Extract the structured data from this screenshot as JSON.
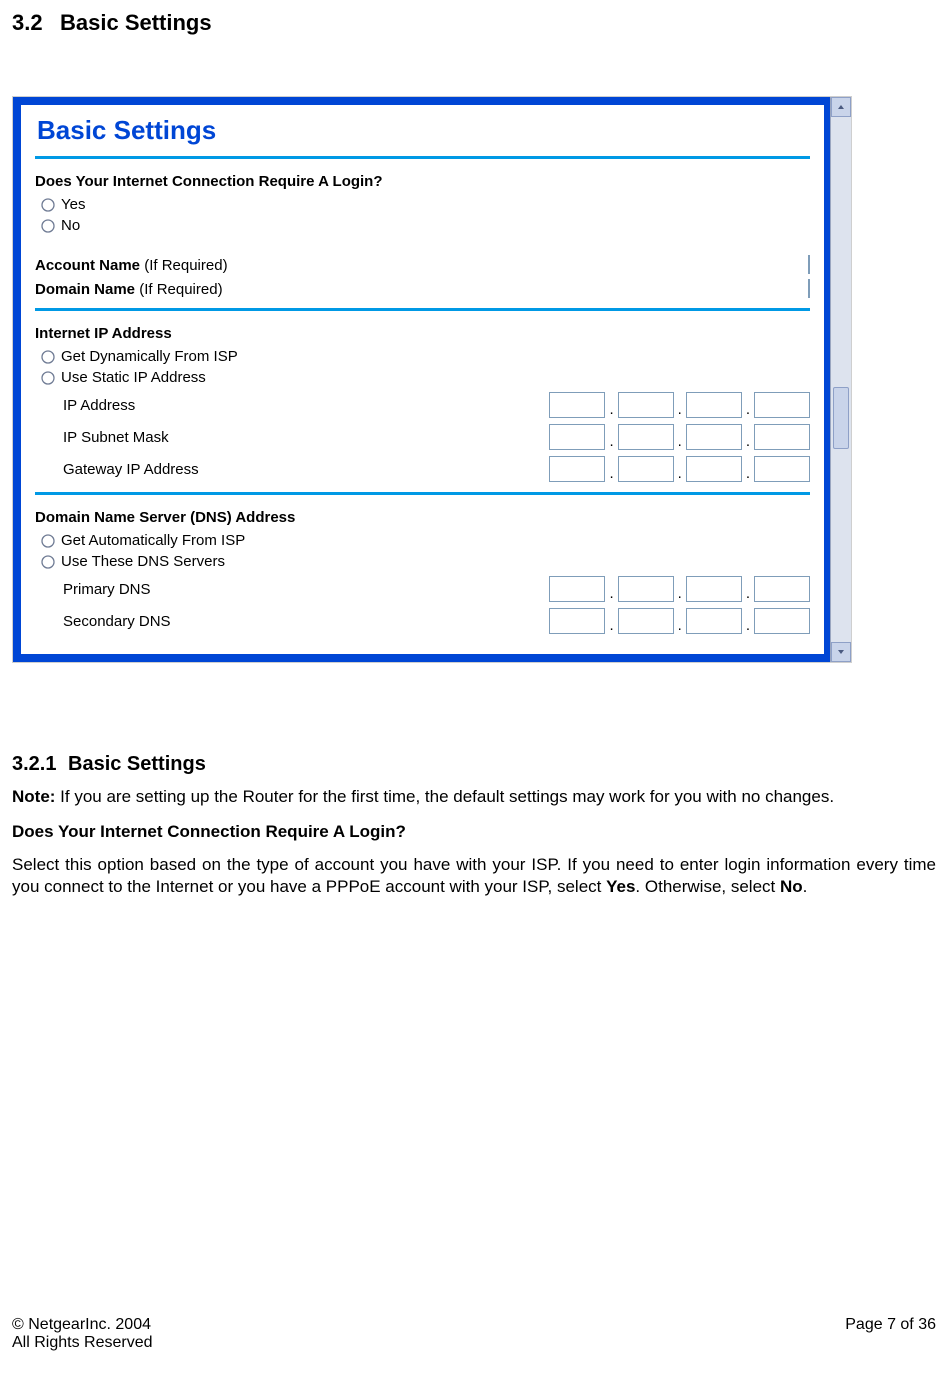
{
  "heading32": {
    "num": "3.2",
    "title": "Basic Settings"
  },
  "screenshot": {
    "brand_title": "Basic Settings",
    "q_login": "Does Your Internet Connection Require A Login?",
    "opt_yes": "Yes",
    "opt_no": "No",
    "account_name_b": "Account Name",
    "account_name_paren": "  (If Required)",
    "domain_name_b": "Domain Name",
    "domain_name_paren": "  (If Required)",
    "sect_ip": "Internet IP Address",
    "ip_dyn": "Get Dynamically From ISP",
    "ip_static": "Use Static IP Address",
    "ip_addr": "IP Address",
    "ip_mask": "IP Subnet Mask",
    "ip_gw": "Gateway IP Address",
    "sect_dns": "Domain Name Server (DNS) Address",
    "dns_auto": "Get Automatically From ISP",
    "dns_use": "Use These DNS Servers",
    "dns_prim": "Primary DNS",
    "dns_sec": "Secondary DNS"
  },
  "heading321": {
    "num": "3.2.1",
    "title": "Basic Settings"
  },
  "note_b": "Note:",
  "note_rest": " If you are setting up the Router for the first time, the default settings may work for you with no changes.",
  "subhead_login": "Does Your Internet Connection Require A Login?",
  "para_login_1": "Select this option based on the type of account you have with your ISP. If you need to enter login information every time you connect to the Internet or you have a PPPoE account with your ISP, select ",
  "para_login_yes": "Yes",
  "para_login_mid": ". Otherwise, select ",
  "para_login_no": "No",
  "para_login_end": ".",
  "footer": {
    "copyright": "© NetgearInc. 2004",
    "rights": "All Rights Reserved",
    "page": "Page 7 of 36"
  }
}
